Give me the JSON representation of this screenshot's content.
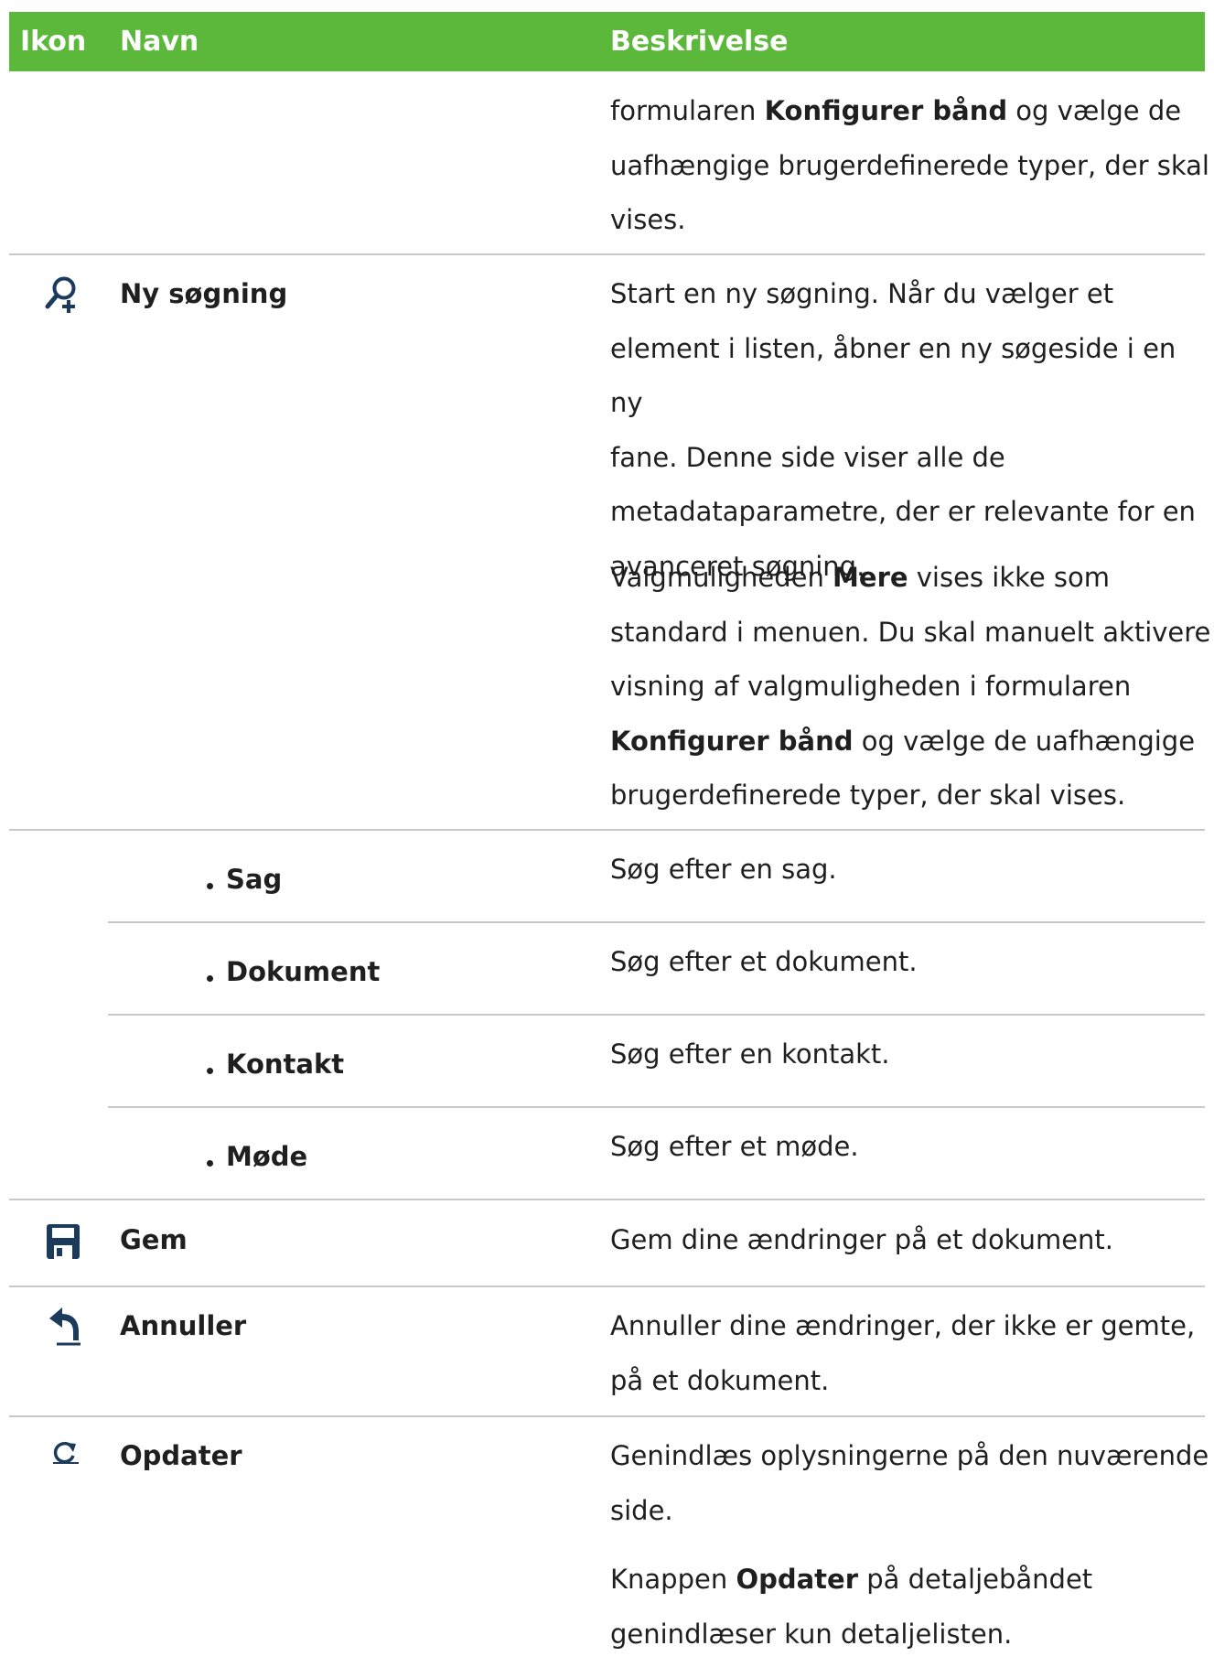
{
  "header": {
    "col_icon": "Ikon",
    "col_name": "Navn",
    "col_desc": "Beskrivelse"
  },
  "row0": {
    "desc_a": "formularen ",
    "desc_b": "Konfigurer bånd",
    "desc_c": " og vælge de",
    "desc_d": "uafhængige brugerdefinerede typer, der skal",
    "desc_e": "vises."
  },
  "row1": {
    "icon": "new-search-icon",
    "name": "Ny søgning",
    "p1_l1": "Start en ny søgning. Når du vælger et",
    "p1_l2": "element i listen, åbner en ny søgeside i en ny",
    "p1_l3": "fane. Denne side viser alle de",
    "p1_l4": "metadataparametre, der er relevante for en",
    "p1_l5": "avanceret søgning.",
    "p2_l1a": "Valgmuligheden ",
    "p2_l1b": "Mere",
    "p2_l1c": " vises ikke som",
    "p2_l2": "standard i menuen. Du skal manuelt aktivere",
    "p2_l3": "visning af valgmuligheden i formularen",
    "p2_l4a": "Konfigurer bånd",
    "p2_l4b": " og vælge de uafhængige",
    "p2_l5": "brugerdefinerede typer, der skal vises."
  },
  "subrows": [
    {
      "name": "Sag",
      "desc": "Søg efter en sag."
    },
    {
      "name": "Dokument",
      "desc": "Søg efter et dokument."
    },
    {
      "name": "Kontakt",
      "desc": "Søg efter en kontakt."
    },
    {
      "name": "Møde",
      "desc": "Søg efter et møde."
    }
  ],
  "row_gem": {
    "icon": "save-icon",
    "name": "Gem",
    "desc": "Gem dine ændringer på et dokument."
  },
  "row_annuller": {
    "icon": "undo-icon",
    "name": "Annuller",
    "desc_l1": "Annuller dine ændringer, der ikke er gemte,",
    "desc_l2": "på et dokument."
  },
  "row_opdater": {
    "icon": "refresh-icon",
    "name": "Opdater",
    "p1_l1": "Genindlæs oplysningerne på den nuværende",
    "p1_l2": "side.",
    "p2_l1a": "Knappen ",
    "p2_l1b": "Opdater",
    "p2_l1c": " på detaljebåndet",
    "p2_l2": "genindlæser kun detaljelisten."
  },
  "colors": {
    "header_bg": "#5cb83a",
    "rule": "#c8c8c8",
    "icon_navy": "#1b3a5c"
  }
}
